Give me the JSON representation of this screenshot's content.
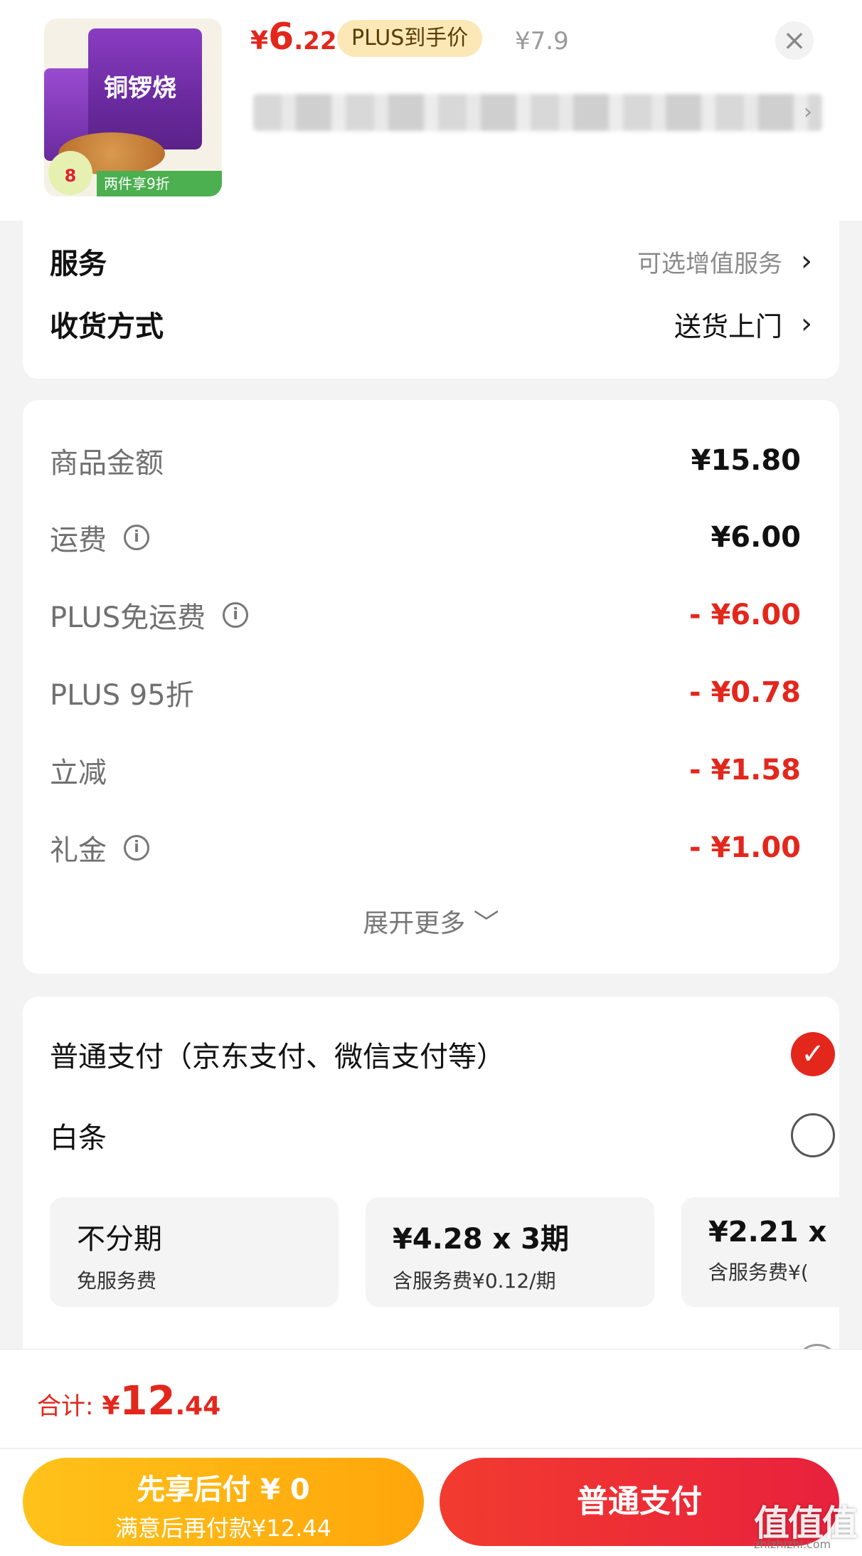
{
  "product": {
    "price_currency": "¥",
    "price_int": "6",
    "price_dec": ".22",
    "plus_tag": "PLUS到手价",
    "original_price": "¥7.9",
    "thumb_title": "铜锣烧",
    "thumb_badge": "8",
    "thumb_promo": "两件享9折"
  },
  "service": {
    "label": "服务",
    "value": "可选增值服务"
  },
  "delivery": {
    "label": "收货方式",
    "value": "送货上门"
  },
  "amounts": {
    "rows": [
      {
        "label": "商品金额",
        "value": "¥15.80"
      },
      {
        "label": "运费",
        "value": "¥6.00"
      },
      {
        "label": "PLUS免运费",
        "value": "- ¥6.00"
      },
      {
        "label": "PLUS 95折",
        "value": "- ¥0.78"
      },
      {
        "label": "立减",
        "value": "- ¥1.58"
      },
      {
        "label": "礼金",
        "value": "- ¥1.00"
      }
    ],
    "expand": "展开更多 ﹀"
  },
  "payment": {
    "normal_label": "普通支付（京东支付、微信支付等）",
    "baitiao_label": "白条",
    "installments": [
      {
        "title": "不分期",
        "sub": "免服务费"
      },
      {
        "title": "¥4.28 x 3期",
        "sub": "含服务费¥0.12/期"
      },
      {
        "title": "¥2.21 x",
        "sub": "含服务费¥("
      }
    ]
  },
  "bottom": {
    "total_label": "合计:",
    "total_currency": "¥",
    "total_int": "12",
    "total_dec": ".44",
    "later_line1": "先享后付 ¥ 0",
    "later_line2": "满意后再付款¥12.44",
    "normal_pay": "普通支付"
  },
  "watermark": {
    "text": "值值值",
    "sub": "zhizhizhi.com"
  },
  "colors": {
    "accent_red": "#e3271c",
    "plus_gold": "#fbe8b6",
    "later_yellow": "#ffb313"
  }
}
